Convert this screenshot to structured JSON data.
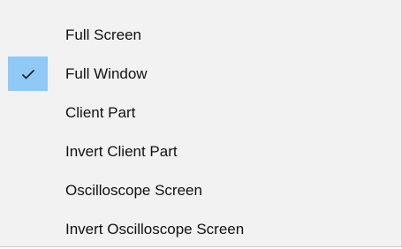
{
  "menu": {
    "items": [
      {
        "label": "Full Screen",
        "checked": false
      },
      {
        "label": "Full Window",
        "checked": true,
        "check_icon": "checkmark-icon"
      },
      {
        "label": "Client Part",
        "checked": false
      },
      {
        "label": "Invert Client Part",
        "checked": false
      },
      {
        "label": "Oscilloscope Screen",
        "checked": false
      },
      {
        "label": "Invert Oscilloscope Screen",
        "checked": false
      }
    ],
    "colors": {
      "background": "#f2f2f2",
      "check_highlight": "#90c8f6",
      "text": "#111111",
      "border": "#cccccc"
    }
  }
}
